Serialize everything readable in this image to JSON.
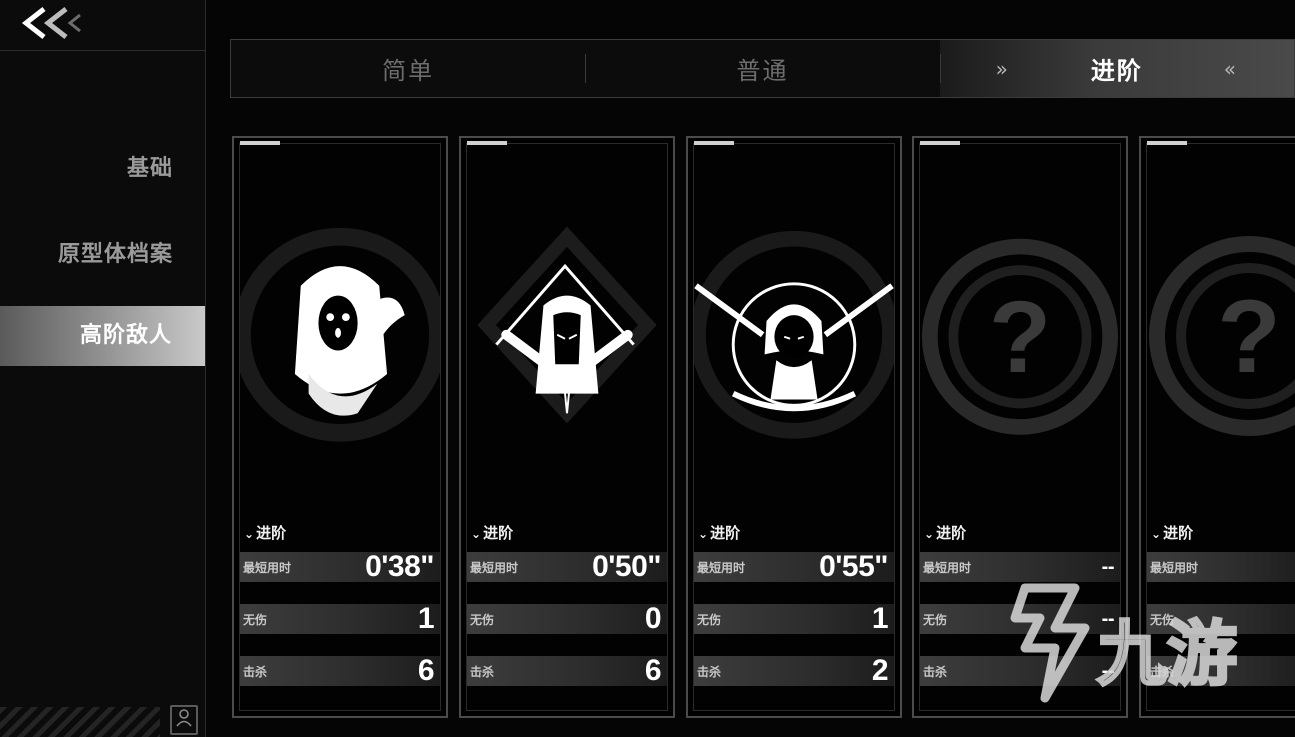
{
  "sidebar": {
    "back_icon": "double-chevron-left-icon",
    "items": [
      {
        "label": "基础"
      },
      {
        "label": "原型体档案"
      },
      {
        "label": "高阶敌人"
      }
    ],
    "active_index": 2,
    "profile_icon": "id-card-icon"
  },
  "tabs": [
    {
      "label": "简单"
    },
    {
      "label": "普通"
    },
    {
      "label": "进阶",
      "deco_left": "»",
      "deco_right": "«"
    }
  ],
  "active_tab": 2,
  "cards": [
    {
      "emblem": "hooded-figure-emblem",
      "difficulty": "进阶",
      "best_time_label": "最短用时",
      "best_time": "0'38\"",
      "no_damage_label": "无伤",
      "no_damage": "1",
      "kills_label": "击杀",
      "kills": "6"
    },
    {
      "emblem": "long-hair-girl-emblem",
      "difficulty": "进阶",
      "best_time_label": "最短用时",
      "best_time": "0'50\"",
      "no_damage_label": "无伤",
      "no_damage": "0",
      "kills_label": "击杀",
      "kills": "6"
    },
    {
      "emblem": "twin-swords-girl-emblem",
      "difficulty": "进阶",
      "best_time_label": "最短用时",
      "best_time": "0'55\"",
      "no_damage_label": "无伤",
      "no_damage": "1",
      "kills_label": "击杀",
      "kills": "2"
    },
    {
      "emblem": "question-mark-emblem",
      "difficulty": "进阶",
      "best_time_label": "最短用时",
      "best_time": "--",
      "no_damage_label": "无伤",
      "no_damage": "--",
      "kills_label": "击杀",
      "kills": "--"
    },
    {
      "emblem": "question-mark-emblem",
      "difficulty": "进阶",
      "best_time_label": "最短用时",
      "best_time": "",
      "no_damage_label": "无伤",
      "no_damage": "",
      "kills_label": "击杀",
      "kills": ""
    }
  ],
  "watermark": {
    "text": "九游"
  }
}
